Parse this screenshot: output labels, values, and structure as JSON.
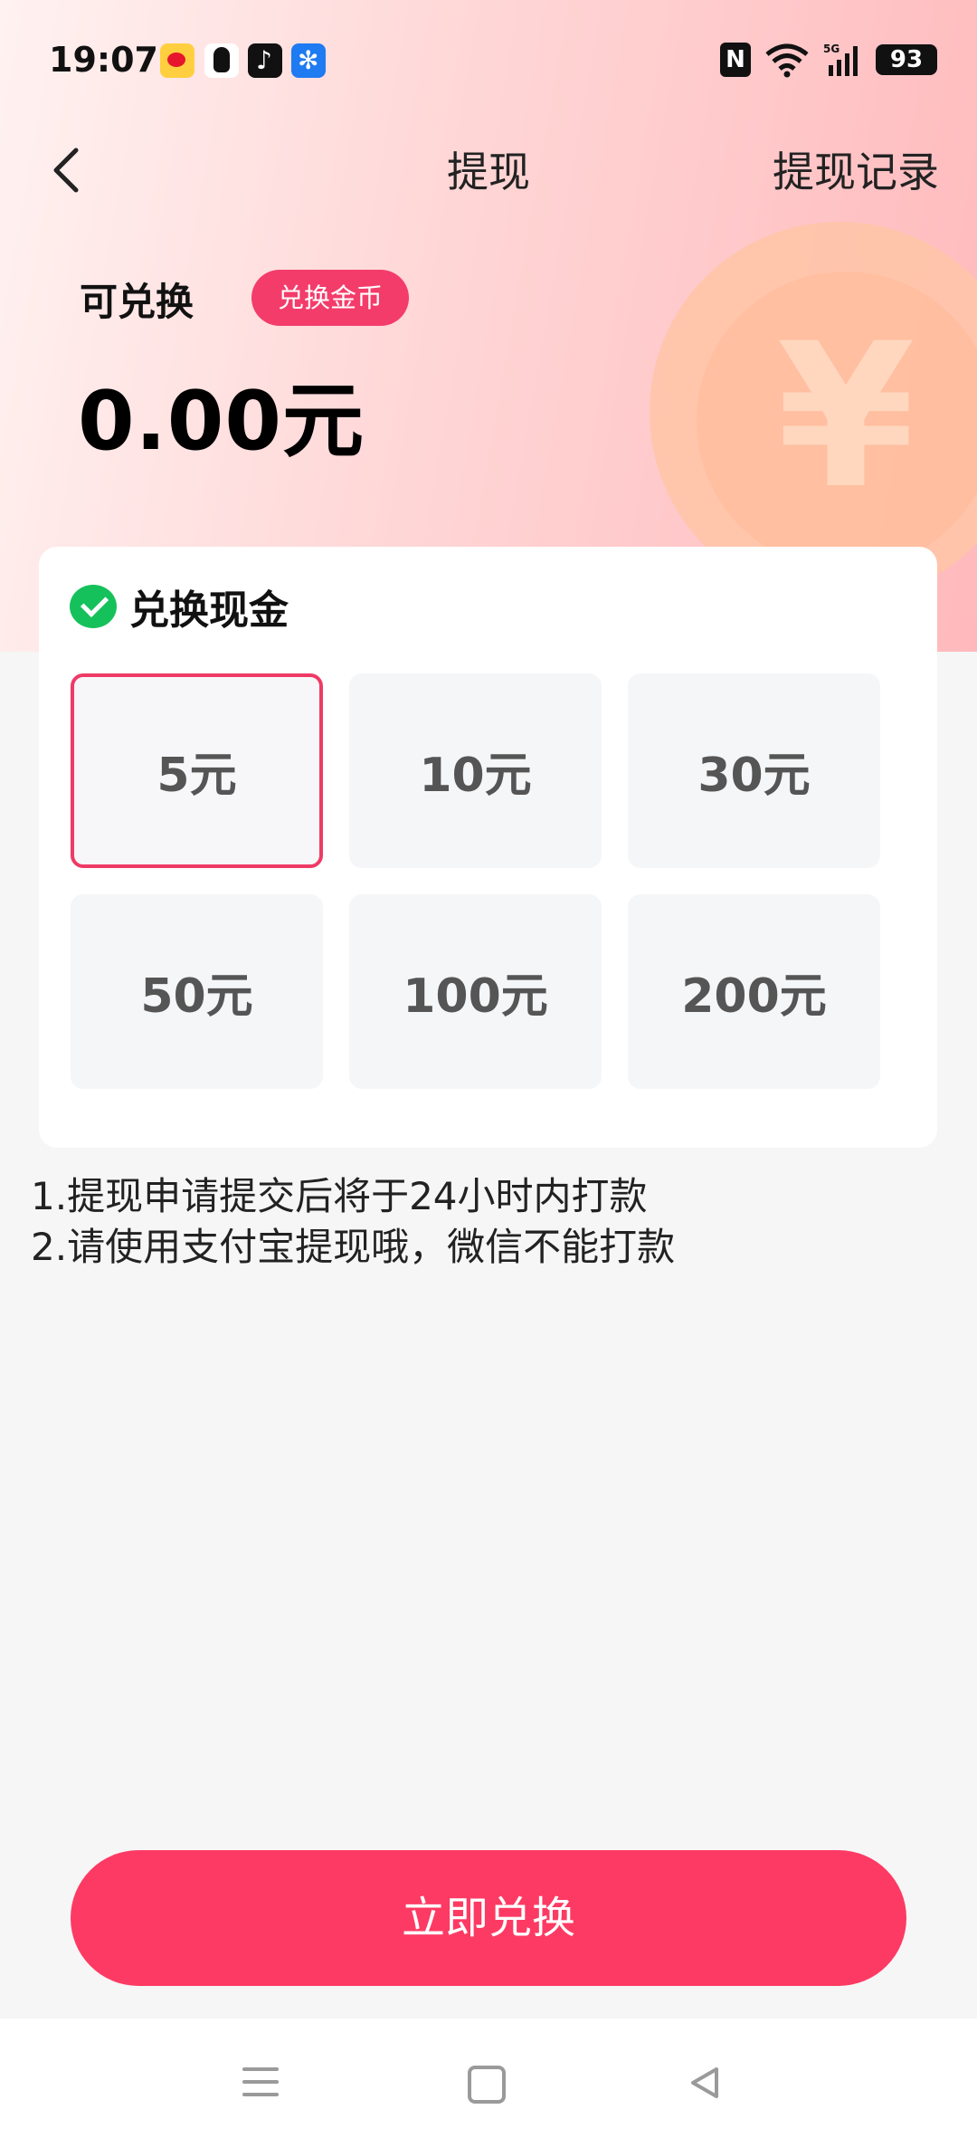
{
  "status_bar": {
    "time": "19:07",
    "app_icons": [
      "weibo-icon",
      "qq-icon",
      "tiktok-icon",
      "fan-icon"
    ],
    "nfc": "N",
    "network": "5G",
    "battery": "93"
  },
  "nav": {
    "title": "提现",
    "record_label": "提现记录"
  },
  "balance": {
    "label": "可兑换",
    "exchange_coins_label": "兑换金币",
    "amount": "0.00元"
  },
  "card": {
    "title": "兑换现金",
    "options": [
      {
        "label": "5元",
        "selected": true
      },
      {
        "label": "10元",
        "selected": false
      },
      {
        "label": "30元",
        "selected": false
      },
      {
        "label": "50元",
        "selected": false
      },
      {
        "label": "100元",
        "selected": false
      },
      {
        "label": "200元",
        "selected": false
      }
    ]
  },
  "notes": [
    "1.提现申请提交后将于24小时内打款",
    "2.请使用支付宝提现哦，微信不能打款"
  ],
  "submit_label": "立即兑换",
  "colors": {
    "accent": "#fd3a63",
    "selected_border": "#ee3b66",
    "wechat_green": "#15c15b"
  }
}
